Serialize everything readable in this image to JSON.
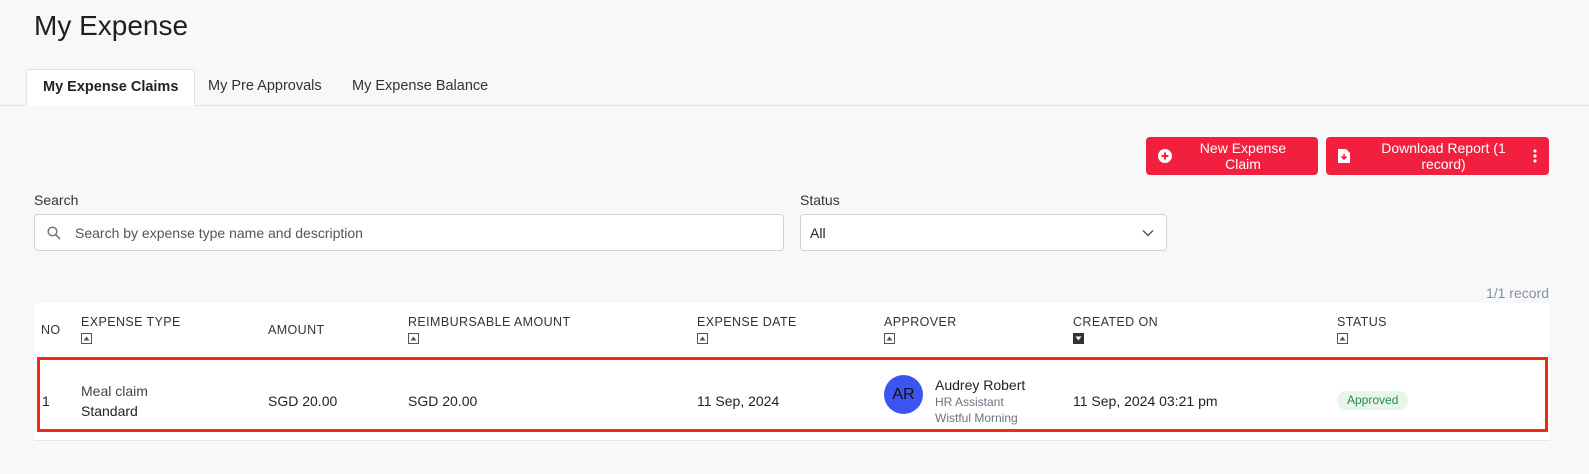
{
  "page": {
    "title": "My Expense"
  },
  "tabs": [
    {
      "label": "My Expense Claims",
      "active": true
    },
    {
      "label": "My Pre Approvals",
      "active": false
    },
    {
      "label": "My Expense Balance",
      "active": false
    }
  ],
  "actions": {
    "new_claim": "New Expense Claim",
    "download_report": "Download Report (1 record)"
  },
  "filters": {
    "search_label": "Search",
    "search_placeholder": "Search by expense type name and description",
    "status_label": "Status",
    "status_value": "All"
  },
  "record_count": "1/1 record",
  "table": {
    "headers": [
      "NO",
      "EXPENSE TYPE",
      "AMOUNT",
      "REIMBURSABLE AMOUNT",
      "EXPENSE DATE",
      "APPROVER",
      "CREATED ON",
      "STATUS"
    ],
    "rows": [
      {
        "no": "1",
        "expense_type": "Meal claim",
        "expense_subtype": "Standard",
        "amount": "SGD 20.00",
        "reimbursable_amount": "SGD 20.00",
        "expense_date": "11 Sep, 2024",
        "approver_initials": "AR",
        "approver_name": "Audrey Robert",
        "approver_title": "HR Assistant",
        "approver_org": "Wistful Morning",
        "created_on": "11 Sep, 2024 03:21 pm",
        "status": "Approved"
      }
    ]
  },
  "colors": {
    "primary": "#f21f3f",
    "avatar": "#3d55f0",
    "approved_bg": "#e6f6ea",
    "approved_text": "#2b8a3e",
    "highlight": "#f0290f"
  }
}
